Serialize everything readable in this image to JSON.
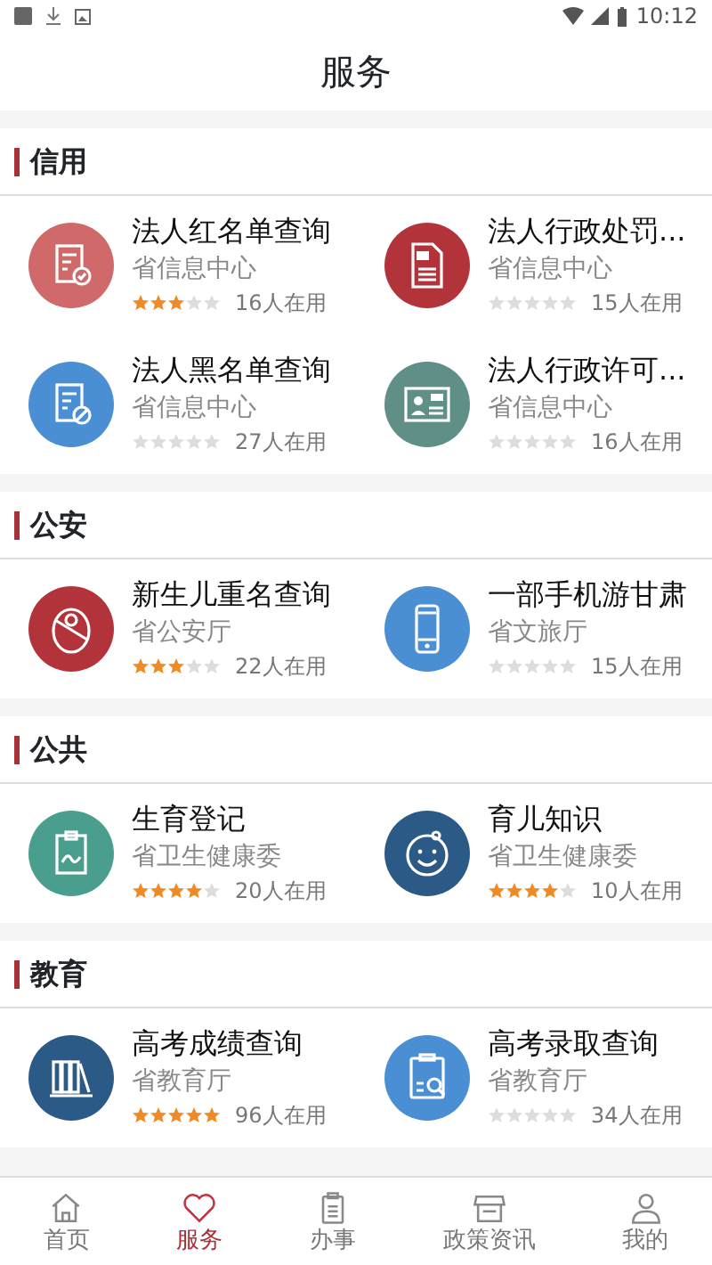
{
  "status_bar": {
    "time": "10:12"
  },
  "header": {
    "title": "服务"
  },
  "sections": [
    {
      "title": "信用",
      "items": [
        {
          "name": "法人红名单查询",
          "org": "省信息中心",
          "stars": 3,
          "usage": "16人在用"
        },
        {
          "name": "法人行政处罚...",
          "org": "省信息中心",
          "stars": 0,
          "usage": "15人在用"
        },
        {
          "name": "法人黑名单查询",
          "org": "省信息中心",
          "stars": 0,
          "usage": "27人在用"
        },
        {
          "name": "法人行政许可...",
          "org": "省信息中心",
          "stars": 0,
          "usage": "16人在用"
        }
      ]
    },
    {
      "title": "公安",
      "items": [
        {
          "name": "新生儿重名查询",
          "org": "省公安厅",
          "stars": 3,
          "usage": "22人在用"
        },
        {
          "name": "一部手机游甘肃",
          "org": "省文旅厅",
          "stars": 0,
          "usage": "15人在用"
        }
      ]
    },
    {
      "title": "公共",
      "items": [
        {
          "name": "生育登记",
          "org": "省卫生健康委",
          "stars": 4,
          "usage": "20人在用"
        },
        {
          "name": "育儿知识",
          "org": "省卫生健康委",
          "stars": 4,
          "usage": "10人在用"
        }
      ]
    },
    {
      "title": "教育",
      "items": [
        {
          "name": "高考成绩查询",
          "org": "省教育厅",
          "stars": 5,
          "usage": "96人在用"
        },
        {
          "name": "高考录取查询",
          "org": "省教育厅",
          "stars": 0,
          "usage": "34人在用"
        }
      ]
    }
  ],
  "tabs": [
    {
      "label": "首页",
      "selected": false
    },
    {
      "label": "服务",
      "selected": true
    },
    {
      "label": "办事",
      "selected": false
    },
    {
      "label": "政策资讯",
      "selected": false
    },
    {
      "label": "我的",
      "selected": false
    }
  ]
}
